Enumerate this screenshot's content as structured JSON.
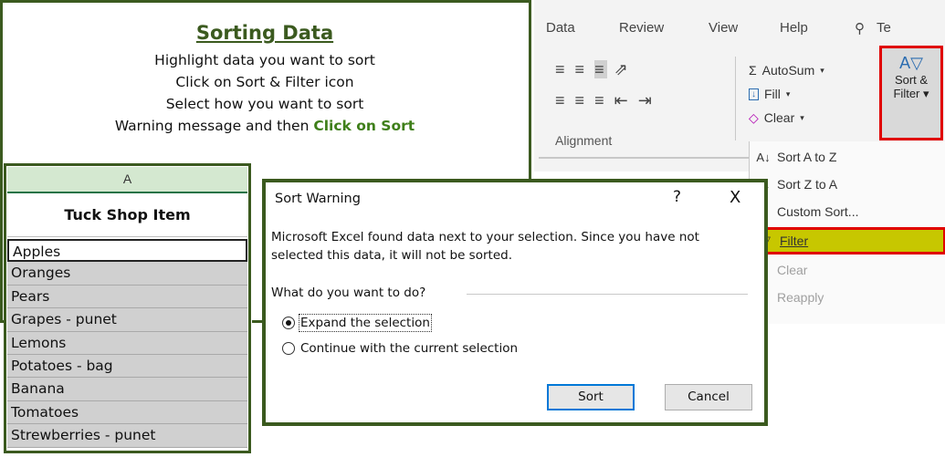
{
  "instructions": {
    "title": "Sorting Data",
    "lines": [
      "Highlight data you want to sort",
      "Click on Sort & Filter icon",
      "Select how you want to sort"
    ],
    "last_line_prefix": "Warning message and then ",
    "last_line_emphasis": "Click on Sort"
  },
  "sheet": {
    "column_header": "A",
    "header_cell": "Tuck Shop Item",
    "items": [
      "Apples",
      "Oranges",
      "Pears",
      "Grapes - punet",
      "Lemons",
      "Potatoes - bag",
      "Banana",
      "Tomatoes",
      "Strewberries - punet"
    ]
  },
  "ribbon": {
    "tabs": [
      "Data",
      "Review",
      "View",
      "Help"
    ],
    "search_partial": "Te",
    "alignment_label": "Alignment",
    "autosum_label": "AutoSum",
    "fill_label": "Fill",
    "clear_label": "Clear",
    "sort_filter_line1": "Sort &",
    "sort_filter_line2": "Filter"
  },
  "menu": {
    "sort_a_to_z": "Sort A to Z",
    "sort_z_to_a": "Sort Z to A",
    "custom_sort": "Custom Sort...",
    "filter": "Filter",
    "clear": "Clear",
    "reapply": "Reapply"
  },
  "dialog": {
    "title": "Sort Warning",
    "help": "?",
    "close": "X",
    "message_line1": "Microsoft Excel found data next to your selection.  Since you have not",
    "message_line2": "selected this data, it will not be sorted.",
    "question": "What do you want to do?",
    "option_expand": "Expand the selection",
    "option_continue": "Continue with the current selection",
    "selected_option": "Expand the selection",
    "sort_button": "Sort",
    "cancel_button": "Cancel"
  },
  "colors": {
    "frame_green": "#3b5a1f",
    "highlight_red": "#e00000",
    "filter_highlight": "#c7c700",
    "excel_green": "#217346"
  }
}
